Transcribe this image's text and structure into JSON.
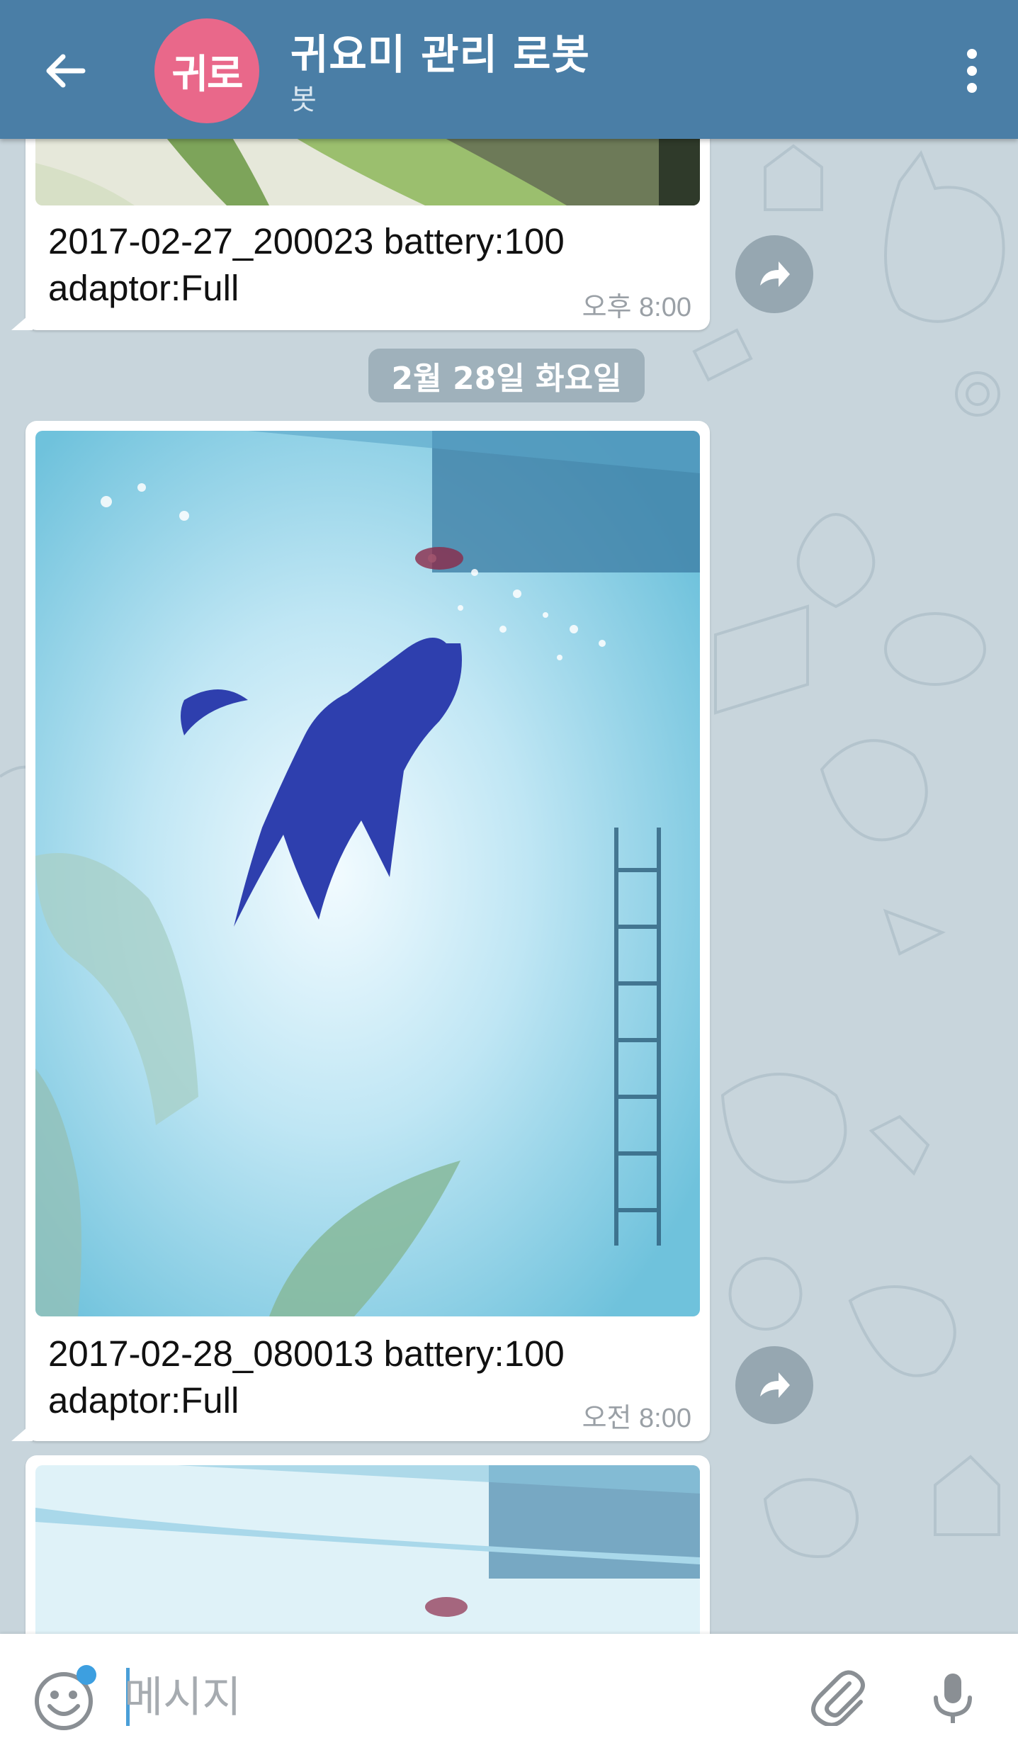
{
  "header": {
    "avatar_text": "귀로",
    "title": "귀요미 관리 로봇",
    "subtitle": "봇",
    "back_icon": "arrow-left-icon",
    "menu_icon": "more-vertical-icon",
    "background_color": "#4a7ea6",
    "avatar_color": "#e9688a"
  },
  "messages": [
    {
      "caption_line1": "2017-02-27_200023 battery:100",
      "caption_line2": "adaptor:Full",
      "time": "오후 8:00",
      "forward_icon": "forward-arrow-icon"
    },
    {
      "caption_line1": "2017-02-28_080013 battery:100",
      "caption_line2": "adaptor:Full",
      "time": "오전 8:00",
      "forward_icon": "forward-arrow-icon"
    }
  ],
  "date_separator": "2월 28일 화요일",
  "input": {
    "placeholder": "메시지",
    "emoji_icon": "smiley-icon",
    "attach_icon": "paperclip-icon",
    "mic_icon": "microphone-icon"
  }
}
